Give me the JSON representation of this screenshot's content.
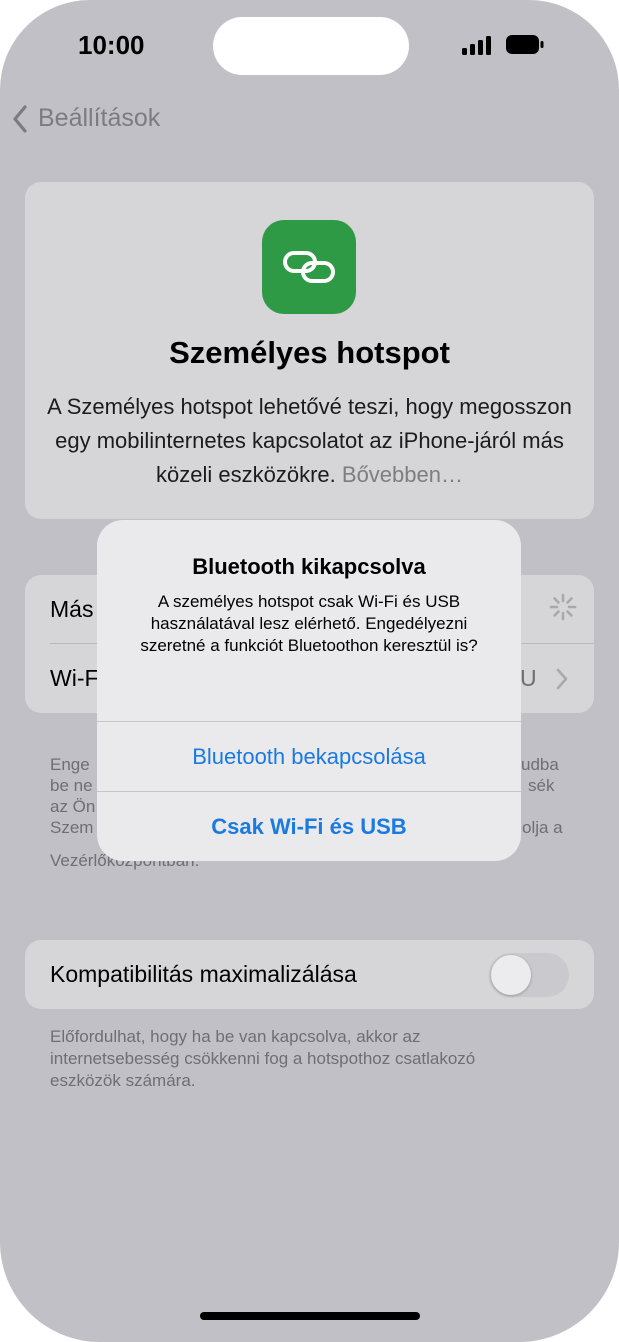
{
  "status_bar": {
    "time": "10:00"
  },
  "nav": {
    "back_label": "Beállítások"
  },
  "hero": {
    "icon": "link-icon",
    "title": "Személyes hotspot",
    "description": "A Személyes hotspot lehetővé teszi, hogy megosszon egy mobilinternetes kapcsolatot az iPhone-járól más közeli eszközökre.",
    "more_link": "Bővebben…"
  },
  "settings_list": {
    "row1_label": "Más",
    "row2_label": "Wi-F",
    "row2_value": "U"
  },
  "info_footnote": {
    "lines": [
      {
        "left": "Enge",
        "right": "udba"
      },
      {
        "left": "be ne",
        "right": "sék"
      },
      {
        "left": "az Ön",
        "right": ""
      },
      {
        "left": "Szem",
        "right": "olja a"
      },
      {
        "left": "Vezérlőközpontban.",
        "right": ""
      }
    ]
  },
  "compatibility": {
    "label": "Kompatibilitás maximalizálása",
    "enabled": false,
    "footnote": "Előfordulhat, hogy ha be van kapcsolva, akkor az internetsebesség csökkenni fog a hotspothoz csatlakozó eszközök számára."
  },
  "alert": {
    "title": "Bluetooth kikapcsolva",
    "message": "A személyes hotspot csak Wi-Fi és USB használatával lesz elérhető. Engedélyezni szeretné a funkciót Bluetoothon keresztül is?",
    "primary_button": "Bluetooth bekapcsolása",
    "secondary_button": "Csak Wi-Fi és USB"
  },
  "colors": {
    "accent": "#1a7ae0",
    "hero_icon_bg": "#2e9a45",
    "dim_background": "#c0c0c6"
  }
}
